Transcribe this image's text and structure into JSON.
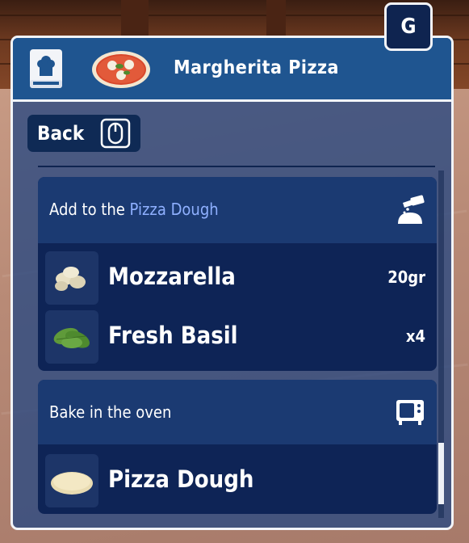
{
  "header": {
    "title": "Margherita Pizza",
    "key_hint": "G",
    "book_icon": "recipe-book-icon",
    "dish_icon": "pizza-icon"
  },
  "back_button": {
    "label": "Back",
    "icon": "mouse-icon"
  },
  "steps": [
    {
      "title_prefix": "Add to the ",
      "title_highlight": "Pizza Dough",
      "icon": "pour-ingredient-icon",
      "items": [
        {
          "name": "Mozzarella",
          "quantity": "20gr",
          "icon": "mozzarella-icon"
        },
        {
          "name": "Fresh Basil",
          "quantity": "x4",
          "icon": "basil-icon"
        }
      ]
    },
    {
      "title_prefix": "Bake in the oven",
      "title_highlight": "",
      "icon": "oven-icon",
      "items": [
        {
          "name": "Pizza Dough",
          "quantity": "",
          "icon": "dough-icon"
        }
      ]
    }
  ],
  "colors": {
    "panel_bg": "#2a4a82",
    "header_bg": "#1f5590",
    "card_bg": "#0e2456",
    "card_head_bg": "#1b3a72",
    "highlight": "#8fb0ff"
  }
}
